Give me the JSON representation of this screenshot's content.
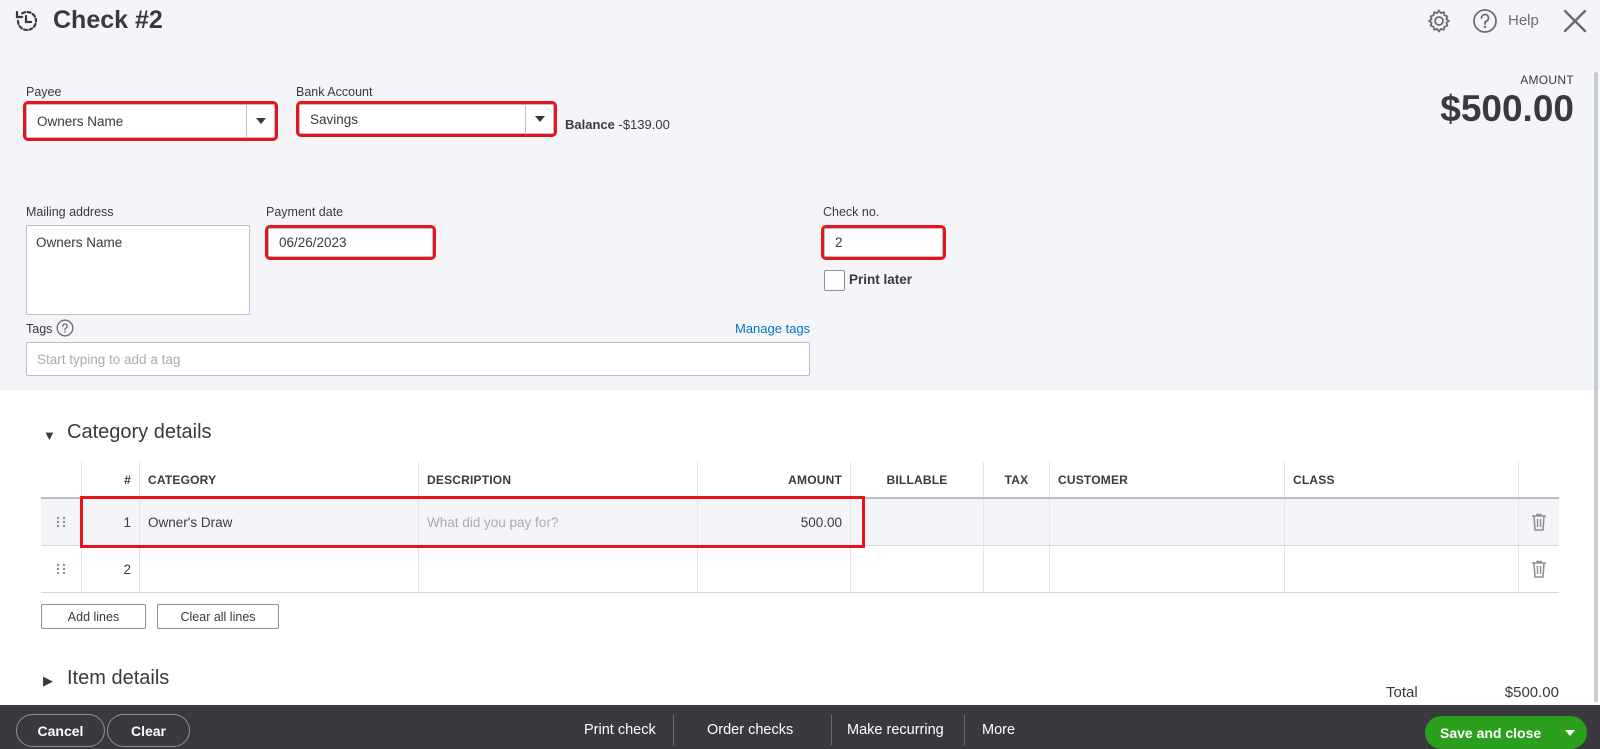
{
  "header": {
    "title": "Check #2",
    "help_label": "Help"
  },
  "form": {
    "payee_label": "Payee",
    "payee_value": "Owners Name",
    "bank_label": "Bank Account",
    "bank_value": "Savings",
    "balance_label": "Balance",
    "balance_value": "-$139.00",
    "amount_label": "AMOUNT",
    "amount_value": "$500.00",
    "mailing_label": "Mailing address",
    "mailing_value": "Owners Name",
    "payment_date_label": "Payment date",
    "payment_date_value": "06/26/2023",
    "check_no_label": "Check no.",
    "check_no_value": "2",
    "print_later_label": "Print later",
    "tags_label": "Tags",
    "manage_tags": "Manage tags",
    "tags_placeholder": "Start typing to add a tag"
  },
  "category_details": {
    "title": "Category details",
    "columns": [
      "#",
      "CATEGORY",
      "DESCRIPTION",
      "AMOUNT",
      "BILLABLE",
      "TAX",
      "CUSTOMER",
      "CLASS"
    ],
    "rows": [
      {
        "num": "1",
        "category": "Owner's Draw",
        "description_placeholder": "What did you pay for?",
        "amount": "500.00"
      },
      {
        "num": "2",
        "category": "",
        "description_placeholder": "",
        "amount": ""
      }
    ],
    "add_lines": "Add lines",
    "clear_all_lines": "Clear all lines"
  },
  "item_details": {
    "title": "Item details"
  },
  "totals": {
    "label": "Total",
    "value": "$500.00"
  },
  "footer": {
    "cancel": "Cancel",
    "clear": "Clear",
    "print_check": "Print check",
    "order_checks": "Order checks",
    "make_recurring": "Make recurring",
    "more": "More",
    "save_and_close": "Save and close"
  },
  "colors": {
    "highlight": "#e8141c",
    "primary_green": "#2ca01c",
    "link_blue": "#0077c5",
    "footer_bg": "#393a3d"
  },
  "icons": [
    "history-icon",
    "gear-icon",
    "help-icon",
    "close-icon",
    "question-icon",
    "drag-handle-icon",
    "trash-icon",
    "chevron-down-icon"
  ]
}
